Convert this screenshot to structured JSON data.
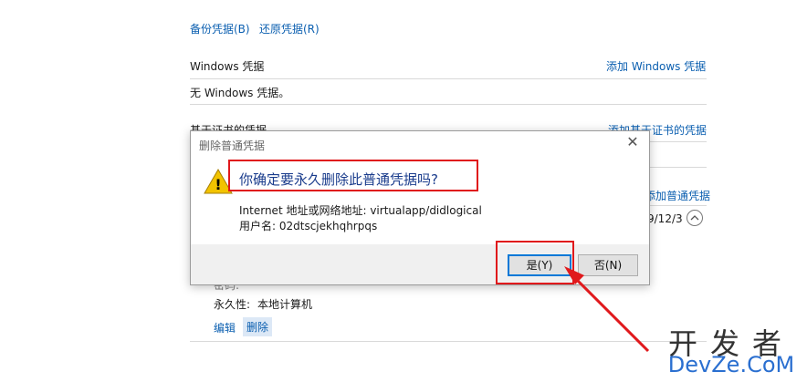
{
  "page": {
    "backup_link": "备份凭据(B)",
    "restore_link": "还原凭据(R)",
    "windows_section": {
      "title": "Windows 凭据",
      "add_link": "添加 Windows 凭据",
      "empty_text": "无 Windows 凭据。"
    },
    "cert_section": {
      "title": "基于证书的凭据",
      "add_link": "添加基于证书的凭据"
    },
    "generic_section": {
      "add_link_partial": "添加普通凭据",
      "date_partial": "9/12/3"
    },
    "credential_detail": {
      "password_partial": "密码:",
      "persistence_label": "永久性:",
      "persistence_value": "本地计算机",
      "edit_link": "编辑",
      "delete_link": "删除"
    }
  },
  "dialog": {
    "title": "删除普通凭据",
    "close_glyph": "✕",
    "warning_glyph": "!",
    "question": "你确定要永久删除此普通凭据吗?",
    "address_label": "Internet 地址或网络地址: virtualapp/didlogical",
    "username_label": "用户名: 02dtscjekhqhrpqs",
    "yes_button": "是(Y)",
    "no_button": "否(N)"
  },
  "watermark": {
    "line1": "开发者",
    "line2": "DevZe.CoM"
  },
  "colors": {
    "link": "#0b5fb0",
    "annotation_red": "#e0191c",
    "dialog_footer": "#f0f0f0",
    "warning_yellow": "#f2c300"
  }
}
